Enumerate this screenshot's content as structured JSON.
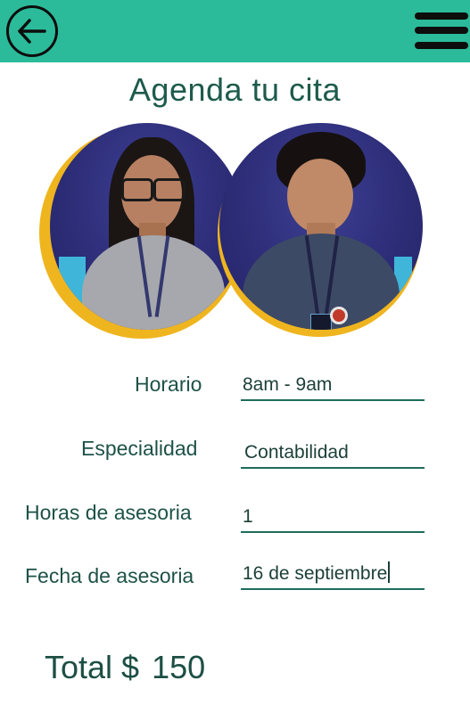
{
  "header": {
    "back_icon": "arrow-left-icon",
    "menu_icon": "hamburger-menu-icon",
    "bar_color": "#2bbb9a"
  },
  "title": "Agenda tu cita",
  "advisors": [
    {
      "name": "advisor-1"
    },
    {
      "name": "advisor-2"
    }
  ],
  "form": {
    "horario": {
      "label": "Horario",
      "value": "8am - 9am"
    },
    "especialidad": {
      "label": "Especialidad",
      "value": "Contabilidad"
    },
    "horas": {
      "label": "Horas de asesoria",
      "value": "1"
    },
    "fecha": {
      "label": "Fecha de asesoria",
      "value": "16 de septiembre"
    }
  },
  "total": {
    "label": "Total $",
    "amount": "150"
  },
  "colors": {
    "accent": "#2bbb9a",
    "ring": "#efb51f",
    "text": "#1d5247"
  }
}
